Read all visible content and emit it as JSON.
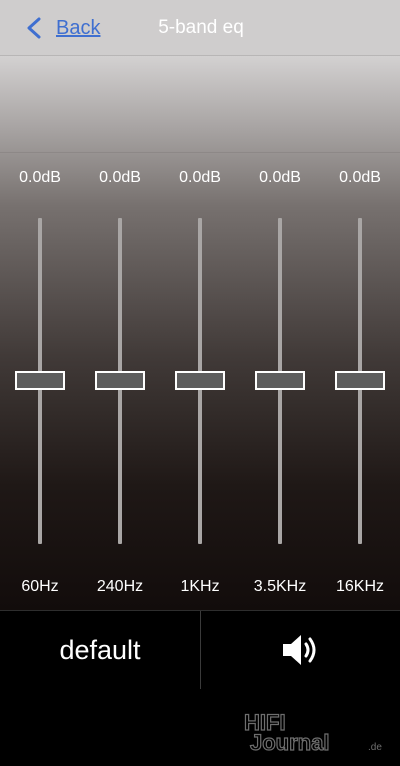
{
  "header": {
    "back_label": "Back",
    "title": "5-band eq"
  },
  "bands": [
    {
      "gain_label": "0.0dB",
      "freq_label": "60Hz",
      "gain_db": 0.0
    },
    {
      "gain_label": "0.0dB",
      "freq_label": "240Hz",
      "gain_db": 0.0
    },
    {
      "gain_label": "0.0dB",
      "freq_label": "1KHz",
      "gain_db": 0.0
    },
    {
      "gain_label": "0.0dB",
      "freq_label": "3.5KHz",
      "gain_db": 0.0
    },
    {
      "gain_label": "0.0dB",
      "freq_label": "16KHz",
      "gain_db": 0.0
    }
  ],
  "controls": {
    "default_label": "default",
    "speaker_icon": "speaker-icon"
  },
  "watermark": {
    "logo_text_top": "HIFI",
    "logo_text_bottom": "Journal",
    "logo_suffix": ".de"
  },
  "colors": {
    "accent": "#3f6fd0",
    "header_bg": "#cfcdcd",
    "thumb_fill": "#5e5e5e"
  }
}
